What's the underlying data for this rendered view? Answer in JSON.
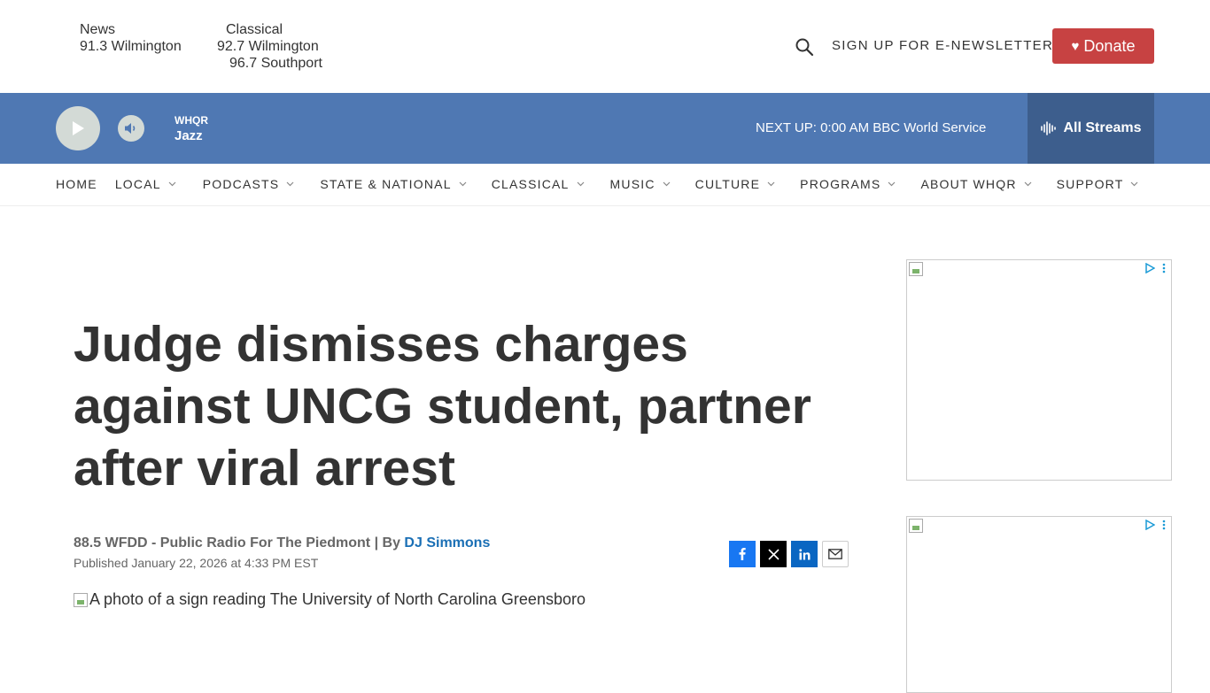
{
  "header": {
    "stations": [
      {
        "lines": [
          "News",
          "91.3 Wilmington"
        ]
      },
      {
        "lines": [
          "Classical",
          "92.7 Wilmington",
          "96.7 Southport"
        ]
      }
    ],
    "signup_label": "SIGN UP FOR E-NEWSLETTERS",
    "donate_label": "Donate",
    "donate_color": "#c74242"
  },
  "player": {
    "station": "WHQR",
    "show": "Jazz",
    "next_up": "NEXT UP: 0:00 AM BBC World Service",
    "all_streams_label": "All Streams",
    "bar_color": "#4f78b3"
  },
  "nav": {
    "items": [
      {
        "label": "HOME",
        "has_dropdown": false
      },
      {
        "label": "LOCAL",
        "has_dropdown": true
      },
      {
        "label": "PODCASTS",
        "has_dropdown": true
      },
      {
        "label": "STATE & NATIONAL",
        "has_dropdown": true
      },
      {
        "label": "CLASSICAL",
        "has_dropdown": true
      },
      {
        "label": "MUSIC",
        "has_dropdown": true
      },
      {
        "label": "CULTURE",
        "has_dropdown": true
      },
      {
        "label": "PROGRAMS",
        "has_dropdown": true
      },
      {
        "label": "ABOUT WHQR",
        "has_dropdown": true
      },
      {
        "label": "SUPPORT",
        "has_dropdown": true
      }
    ]
  },
  "article": {
    "headline": "Judge dismisses charges against UNCG student, partner after viral arrest",
    "source": "88.5 WFDD - Public Radio For The Piedmont",
    "by": "| By",
    "author": "DJ Simmons",
    "published": "Published January 22, 2026 at 4:33 PM EST",
    "photo_alt": "A photo of a sign reading The University of North Carolina Greensboro"
  },
  "share": {
    "icons": [
      "facebook-icon",
      "x-icon",
      "linkedin-icon",
      "email-icon"
    ]
  }
}
